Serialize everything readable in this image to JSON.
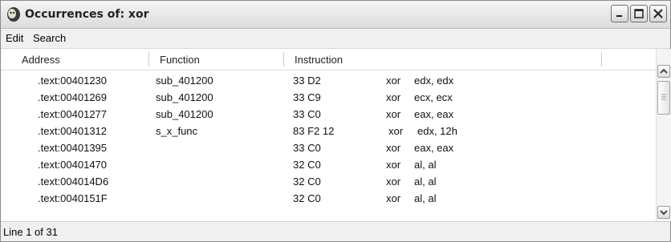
{
  "window": {
    "title": "Occurrences of: xor",
    "controls": [
      "minimize-icon",
      "maximize-icon",
      "close-icon"
    ]
  },
  "menubar": {
    "items": [
      {
        "label": "Edit"
      },
      {
        "label": "Search"
      }
    ]
  },
  "table": {
    "columns": [
      "Address",
      "Function",
      "Instruction"
    ],
    "rows": [
      {
        "address": ".text:00401230",
        "function": "sub_401200",
        "bytes": "33 D2",
        "mnemonic": "xor",
        "operands": "edx, edx"
      },
      {
        "address": ".text:00401269",
        "function": "sub_401200",
        "bytes": "33 C9",
        "mnemonic": "xor",
        "operands": "ecx, ecx"
      },
      {
        "address": ".text:00401277",
        "function": "sub_401200",
        "bytes": "33 C0",
        "mnemonic": "xor",
        "operands": "eax, eax"
      },
      {
        "address": ".text:00401312",
        "function": "s_x_func",
        "bytes": "83 F2 12",
        "mnemonic": "xor",
        "operands": "edx, 12h"
      },
      {
        "address": ".text:00401395",
        "function": "",
        "bytes": "33 C0",
        "mnemonic": "xor",
        "operands": "eax, eax"
      },
      {
        "address": ".text:00401470",
        "function": "",
        "bytes": "32 C0",
        "mnemonic": "xor",
        "operands": "al, al"
      },
      {
        "address": ".text:004014D6",
        "function": "",
        "bytes": "32 C0",
        "mnemonic": "xor",
        "operands": "al, al"
      },
      {
        "address": ".text:0040151F",
        "function": "",
        "bytes": "32 C0",
        "mnemonic": "xor",
        "operands": "al, al"
      }
    ]
  },
  "statusbar": {
    "text": "Line 1 of 31"
  }
}
